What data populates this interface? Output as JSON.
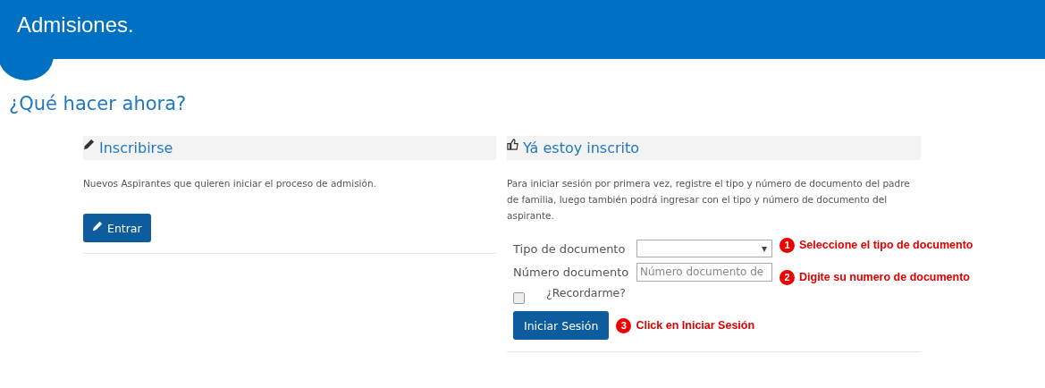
{
  "header": {
    "title": "Admisiones."
  },
  "heading": "¿Qué hacer ahora?",
  "panels": [
    {
      "kind": "register",
      "title": "Inscribirse",
      "text": "Nuevos Aspirantes que quieren iniciar el proceso de admisión.",
      "button": "Entrar"
    },
    {
      "kind": "login",
      "title": "Yá estoy inscrito",
      "text": "Para iniciar sesión por primera vez, registre el tipo y número de documento del padre de familia, luego también podrá ingresar con el tipo y número de documento del aspirante.",
      "fields": [
        {
          "kind": "select",
          "label": "Tipo de documento",
          "callout": {
            "number": "1",
            "text": "Seleccione el tipo de documento"
          }
        },
        {
          "kind": "text",
          "label": "Número documento",
          "placeholder": "Número documento de",
          "callout": {
            "number": "2",
            "text": "Digite su numero de documento"
          }
        },
        {
          "kind": "checkbox",
          "label": "¿Recordarme?",
          "checked": false
        }
      ],
      "button": "Iniciar Sesión",
      "callout": {
        "number": "3",
        "text": "Click en Iniciar Sesión"
      }
    }
  ]
}
